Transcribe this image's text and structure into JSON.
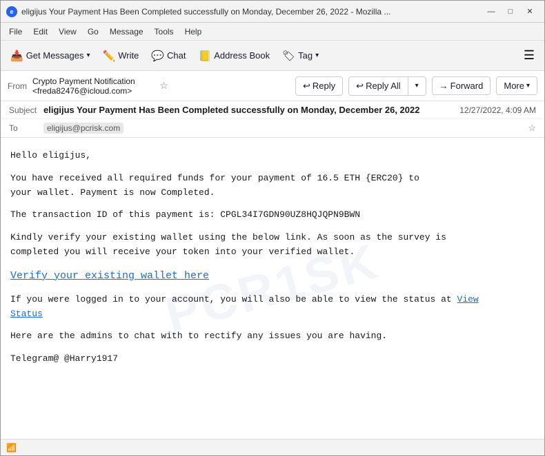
{
  "window": {
    "title": "eligijus Your Payment Has Been Completed successfully on Monday, December 26, 2022 - Mozilla ...",
    "icon": "e"
  },
  "window_controls": {
    "minimize": "—",
    "maximize": "□",
    "close": "✕"
  },
  "menu": {
    "items": [
      "File",
      "Edit",
      "View",
      "Go",
      "Message",
      "Tools",
      "Help"
    ]
  },
  "toolbar": {
    "get_messages_label": "Get Messages",
    "write_label": "Write",
    "chat_label": "Chat",
    "address_book_label": "Address Book",
    "tag_label": "Tag"
  },
  "action_buttons": {
    "reply_label": "Reply",
    "reply_all_label": "Reply All",
    "forward_label": "Forward",
    "more_label": "More"
  },
  "email": {
    "from_label": "From",
    "from_value": "Crypto Payment Notification <freda82476@icloud.com>",
    "subject_label": "Subject",
    "subject_value": "eligijus Your Payment Has Been Completed successfully on Monday, December 26, 2022",
    "date": "12/27/2022, 4:09 AM",
    "to_label": "To",
    "to_value": "eligijus@pcrisk.com"
  },
  "body": {
    "greeting": "Hello eligijus,",
    "para1": "You have received all required funds for your payment of 16.5 ETH {ERC20}  to\nyour wallet. Payment is now Completed.",
    "para2": "The transaction ID of this payment is: CPGL34I7GDN90UZ8HQJQPN9BWN",
    "para3": "Kindly verify your existing wallet using the below link. As soon as the survey is\ncompleted you will receive your token into your verified wallet.",
    "verify_link": "Verify your existing wallet here",
    "para4_before": "If you were logged in to your account, you will also be able to view the status at ",
    "view_status_link": "View\nStatus",
    "para5": "Here are the admins to chat with to rectify any issues you are having.",
    "para6": "Telegram@ @Harry1917"
  },
  "watermark": "PCR1SK",
  "status_bar": {
    "icon": "📶"
  }
}
